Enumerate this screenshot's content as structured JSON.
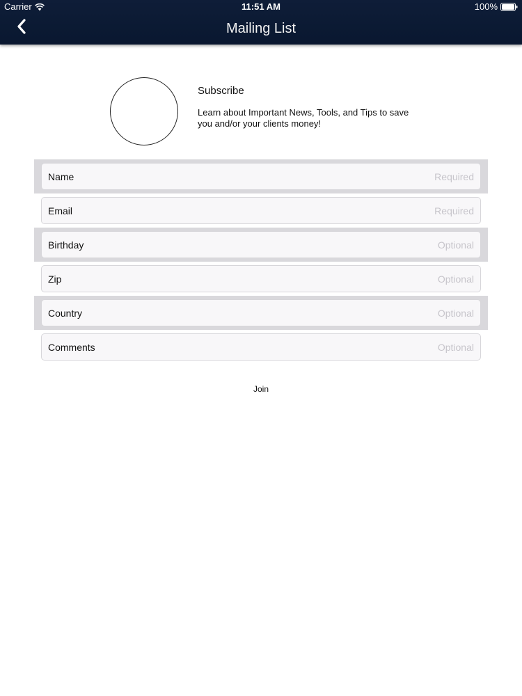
{
  "status_bar": {
    "carrier": "Carrier",
    "time": "11:51 AM",
    "battery": "100%"
  },
  "nav": {
    "title": "Mailing List",
    "back_icon": "chevron-left-icon"
  },
  "subscribe": {
    "title": "Subscribe",
    "description": "Learn about Important News, Tools, and Tips to save you and/or your clients money!"
  },
  "form": {
    "fields": [
      {
        "label": "Name",
        "hint": "Required"
      },
      {
        "label": "Email",
        "hint": "Required"
      },
      {
        "label": "Birthday",
        "hint": "Optional"
      },
      {
        "label": "Zip",
        "hint": "Optional"
      },
      {
        "label": "Country",
        "hint": "Optional"
      },
      {
        "label": "Comments",
        "hint": "Optional"
      }
    ]
  },
  "join_label": "Join",
  "colors": {
    "nav_bar": "#0b1a33",
    "row_shade": "#d9d8dc",
    "field_bg": "#f8f7f9",
    "hint_text": "#c7c5cb"
  }
}
